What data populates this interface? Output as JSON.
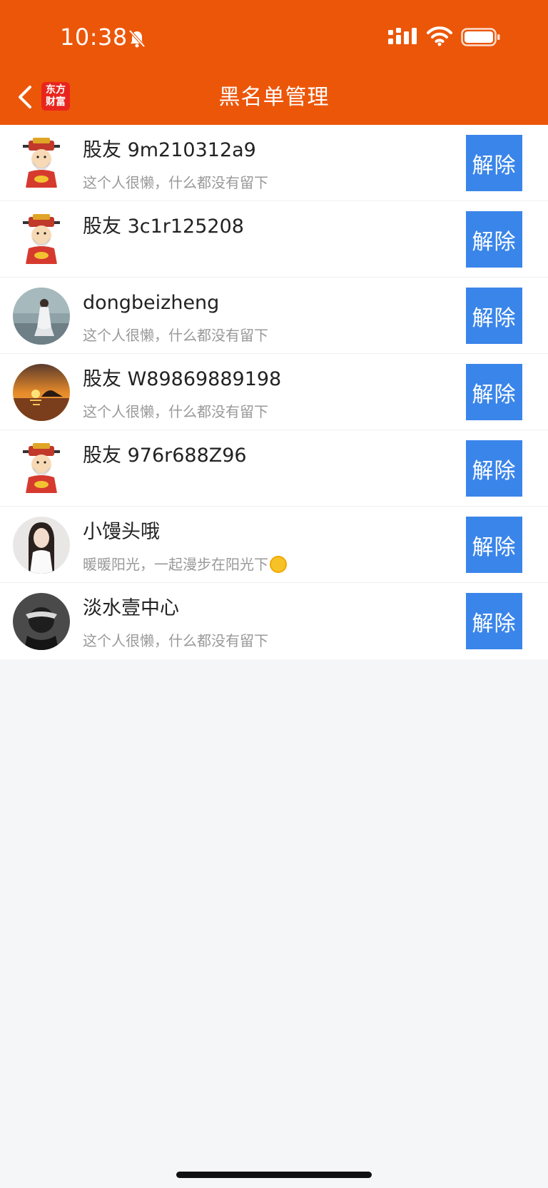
{
  "theme": {
    "brand": "#ec5609",
    "accent": "#3a85ea"
  },
  "status_bar": {
    "time": "10:38",
    "icons": [
      "bell-muted-icon",
      "signal-icon",
      "wifi-icon",
      "battery-icon"
    ]
  },
  "nav": {
    "title": "黑名单管理",
    "back_icon": "chevron-left-icon",
    "logo_line1": "东方",
    "logo_line2": "财富"
  },
  "blocked_users": [
    {
      "name": "股友 9m210312a9",
      "signature": "这个人很懒，什么都没有留下",
      "avatar": "caishen-avatar",
      "action": "解除"
    },
    {
      "name": "股友 3c1r125208",
      "signature": "",
      "avatar": "caishen-avatar",
      "action": "解除"
    },
    {
      "name": "dongbeizheng",
      "signature": "这个人很懒，什么都没有留下",
      "avatar": "photo-avatar-woman-white-dress",
      "action": "解除"
    },
    {
      "name": "股友 W89869889198",
      "signature": "这个人很懒，什么都没有留下",
      "avatar": "photo-avatar-sunset",
      "action": "解除"
    },
    {
      "name": "股友 976r688Z96",
      "signature": "",
      "avatar": "caishen-avatar",
      "action": "解除"
    },
    {
      "name": "小馒头哦",
      "signature": "暖暖阳光，一起漫步在阳光下",
      "signature_emoji": "sun-emoji",
      "avatar": "photo-avatar-woman-long-hair",
      "action": "解除"
    },
    {
      "name": "淡水壹中心",
      "signature": "这个人很懒，什么都没有留下",
      "avatar": "photo-avatar-bw-face",
      "action": "解除"
    }
  ]
}
